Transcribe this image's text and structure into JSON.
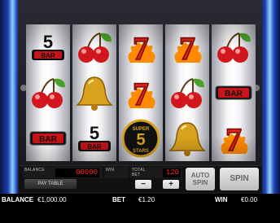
{
  "reels": [
    [
      "5bar",
      "cherries",
      "bar"
    ],
    [
      "cherries",
      "bell",
      "5bar"
    ],
    [
      "seven",
      "seven",
      "super5stars"
    ],
    [
      "seven",
      "cherries",
      "bell"
    ],
    [
      "cherries",
      "bar",
      "seven"
    ]
  ],
  "symbols": {
    "bar_text": "BAR",
    "five_text": "5",
    "super_text": "SUPER",
    "stars_text": "STARS",
    "seven_text": "7"
  },
  "panel": {
    "balance_label": "BALANCE",
    "balance_led": "00000",
    "win_label": "WIN",
    "total_bet_label_1": "TOTAL",
    "total_bet_label_2": "BET",
    "total_bet_led": "120",
    "pay_table": "PAY TABLE",
    "minus": "−",
    "plus": "+",
    "auto_1": "AUTO",
    "auto_2": "SPIN",
    "spin": "SPIN"
  },
  "status": {
    "balance_label": "BALANCE",
    "balance_value": "€1,000.00",
    "bet_label": "BET",
    "bet_value": "€1.20",
    "win_label": "WIN",
    "win_value": "€0.00"
  },
  "colors": {
    "seven": "#e0241a",
    "flame": "#ff8a00",
    "bar_bg": "#c8141a",
    "gold": "#d9a21c",
    "cherry": "#d2161e",
    "leaf": "#4aa02a"
  }
}
